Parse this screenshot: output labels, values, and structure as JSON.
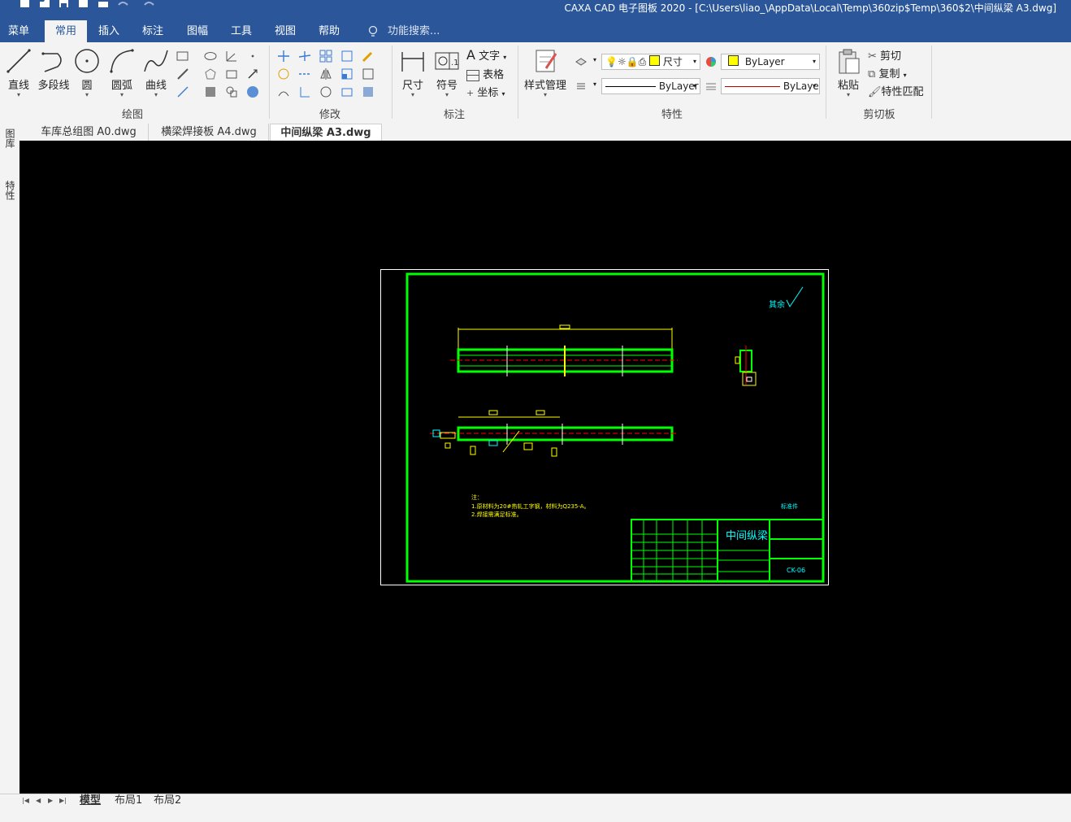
{
  "window": {
    "title": "CAXA CAD 电子图板 2020 - [C:\\Users\\liao_\\AppData\\Local\\Temp\\360zip$Temp\\360$2\\中间纵梁 A3.dwg]"
  },
  "menu": {
    "tabs": [
      "菜单",
      "常用",
      "插入",
      "标注",
      "图幅",
      "工具",
      "视图",
      "帮助"
    ],
    "active": "常用",
    "search_placeholder": "功能搜索..."
  },
  "ribbon": {
    "draw": {
      "label": "绘图",
      "buttons": [
        "直线",
        "多段线",
        "圆",
        "圆弧",
        "曲线"
      ]
    },
    "modify": {
      "label": "修改"
    },
    "annotate": {
      "label": "标注",
      "buttons": [
        "尺寸",
        "符号"
      ],
      "small": [
        "文字",
        "表格",
        "坐标"
      ]
    },
    "properties": {
      "label": "特性",
      "style_button": "样式管理",
      "layer_text": "尺寸",
      "color_value": "ByLayer",
      "linetype_value": "ByLayer",
      "lineweight_value": "ByLaye"
    },
    "clipboard": {
      "label": "剪切板",
      "paste": "粘贴",
      "cut": "剪切",
      "copy": "复制",
      "match": "特性匹配"
    }
  },
  "side_panels": [
    "图库",
    "特性"
  ],
  "doc_tabs": {
    "items": [
      "车库总组图 A0.dwg",
      "横梁焊接板 A4.dwg",
      "中间纵梁 A3.dwg"
    ],
    "active": "中间纵梁 A3.dwg",
    "close": "×"
  },
  "drawing": {
    "surface_roughness": "其余",
    "title_block_name": "中间纵梁",
    "drawing_number": "CK-06",
    "notes_title": "注：",
    "notes": [
      "1.原材料为20#热轧工字钢，材料为Q235-A。",
      "2.焊接需满足标准。"
    ],
    "note_right": "标准件"
  },
  "bottom_tabs": {
    "items": [
      "模型",
      "布局1",
      "布局2"
    ],
    "active": "模型"
  },
  "colors": {
    "titlebar": "#2b579a",
    "ribbon_bg": "#f3f3f3",
    "canvas_bg": "#000000",
    "frame": "#00ff00",
    "dimension": "#ffff00",
    "text_cyan": "#00ffff",
    "centerline": "#ff0000"
  }
}
